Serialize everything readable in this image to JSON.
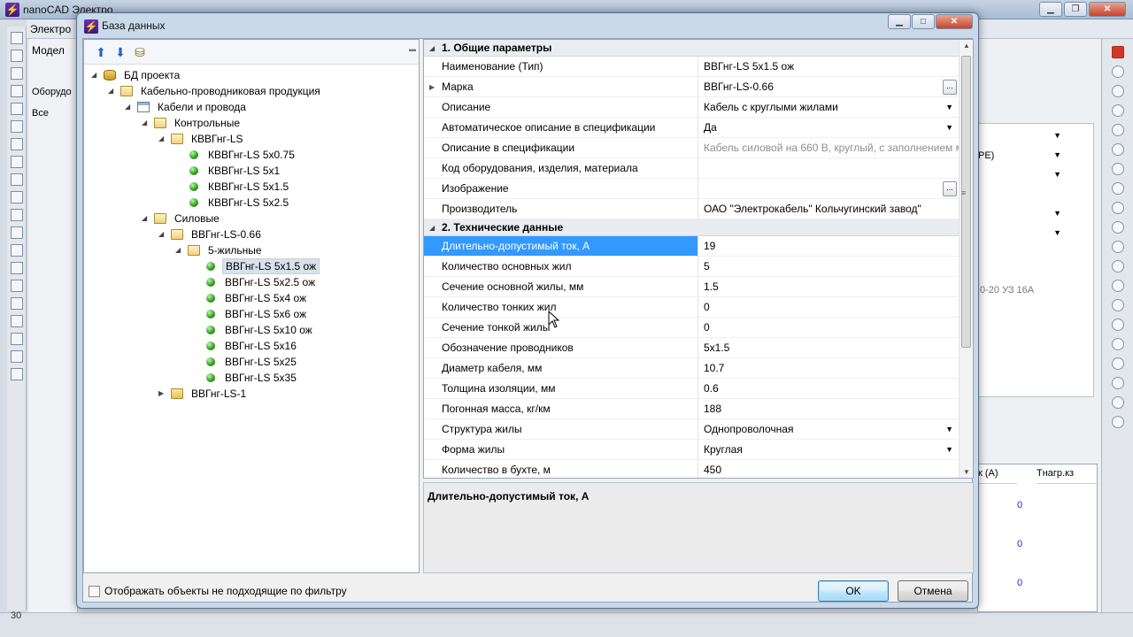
{
  "background_app": {
    "title": "nanoCAD Электро",
    "ribbon_title": "Электро",
    "panel_tab": "Модел",
    "panel_tab2": "Оборудо",
    "panel_filter": "Все",
    "right_rows": [
      "PE)"
    ],
    "right_label": "0-20 УЗ 16А",
    "right_table_header1": "к (А)",
    "right_table_header2": "Тнагр.кз",
    "right_table_values": [
      "0",
      "0",
      "0"
    ],
    "status_number": "30"
  },
  "dialog": {
    "title": "База данных",
    "tree": [
      {
        "label": "БД проекта",
        "level": 0,
        "icon": "database-icon",
        "expanded": true
      },
      {
        "label": "Кабельно-проводниковая продукция",
        "level": 1,
        "icon": "folder-open-icon",
        "expanded": true
      },
      {
        "label": "Кабели и провода",
        "level": 2,
        "icon": "table-icon",
        "expanded": true
      },
      {
        "label": "Контрольные",
        "level": 3,
        "icon": "folder-open-icon",
        "expanded": true
      },
      {
        "label": "КВВГнг-LS",
        "level": 4,
        "icon": "folder-open-icon",
        "expanded": true
      },
      {
        "label": "КВВГнг-LS 5x0.75",
        "level": 5,
        "icon": "item-ball-icon"
      },
      {
        "label": "КВВГнг-LS 5x1",
        "level": 5,
        "icon": "item-ball-icon"
      },
      {
        "label": "КВВГнг-LS 5x1.5",
        "level": 5,
        "icon": "item-ball-icon"
      },
      {
        "label": "КВВГнг-LS 5x2.5",
        "level": 5,
        "icon": "item-ball-icon"
      },
      {
        "label": "Силовые",
        "level": 3,
        "icon": "folder-open-icon",
        "expanded": true
      },
      {
        "label": "ВВГнг-LS-0.66",
        "level": 4,
        "icon": "folder-open-icon",
        "expanded": true
      },
      {
        "label": "5-жильные",
        "level": 5,
        "icon": "folder-open-icon",
        "expanded": true
      },
      {
        "label": "ВВГнг-LS 5x1.5 ож",
        "level": 6,
        "icon": "item-ball-icon",
        "selected": true
      },
      {
        "label": "ВВГнг-LS 5x2.5 ож",
        "level": 6,
        "icon": "item-ball-icon"
      },
      {
        "label": "ВВГнг-LS 5x4 ож",
        "level": 6,
        "icon": "item-ball-icon"
      },
      {
        "label": "ВВГнг-LS 5x6 ож",
        "level": 6,
        "icon": "item-ball-icon"
      },
      {
        "label": "ВВГнг-LS 5x10 ож",
        "level": 6,
        "icon": "item-ball-icon"
      },
      {
        "label": "ВВГнг-LS 5x16",
        "level": 6,
        "icon": "item-ball-icon"
      },
      {
        "label": "ВВГнг-LS 5x25",
        "level": 6,
        "icon": "item-ball-icon"
      },
      {
        "label": "ВВГнг-LS 5x35",
        "level": 6,
        "icon": "item-ball-icon"
      },
      {
        "label": "ВВГнг-LS-1",
        "level": 4,
        "icon": "folder-icon",
        "expanded": false
      }
    ],
    "categories": {
      "general": "1. Общие параметры",
      "technical": "2. Технические данные"
    },
    "properties_general": [
      {
        "name": "Наименование (Тип)",
        "value": "ВВГнг-LS 5x1.5 ож"
      },
      {
        "name": "Марка",
        "value": "ВВГнг-LS-0.66",
        "expandable": true,
        "button": "..."
      },
      {
        "name": "Описание",
        "value": "Кабель с круглыми жилами",
        "dropdown": true
      },
      {
        "name": "Автоматическое описание в спецификации",
        "value": "Да",
        "dropdown": true
      },
      {
        "name": "Описание в спецификации",
        "value": "Кабель силовой на 660 В, круглый, с заполнением м",
        "gray": true
      },
      {
        "name": "Код оборудования, изделия, материала",
        "value": ""
      },
      {
        "name": "Изображение",
        "value": "",
        "button": "..."
      },
      {
        "name": "Производитель",
        "value": "ОАО \"Электрокабель\" Кольчугинский завод\""
      }
    ],
    "properties_technical": [
      {
        "name": "Длительно-допустимый ток, А",
        "value": "19",
        "selected": true
      },
      {
        "name": "Количество основных жил",
        "value": "5"
      },
      {
        "name": "Сечение основной жилы, мм",
        "value": "1.5"
      },
      {
        "name": "Количество тонких жил",
        "value": "0"
      },
      {
        "name": "Сечение тонкой жилы",
        "value": "0"
      },
      {
        "name": "Обозначение проводников",
        "value": "5x1.5"
      },
      {
        "name": "Диаметр кабеля, мм",
        "value": "10.7"
      },
      {
        "name": "Толщина изоляции, мм",
        "value": "0.6"
      },
      {
        "name": "Погонная масса, кг/км",
        "value": "188"
      },
      {
        "name": "Структура жилы",
        "value": "Однопроволочная",
        "dropdown": true
      },
      {
        "name": "Форма жилы",
        "value": "Круглая",
        "dropdown": true
      },
      {
        "name": "Количество в бухте, м",
        "value": "450"
      }
    ],
    "description_title": "Длительно-допустимый ток, А",
    "filter_checkbox_label": "Отображать объекты не подходящие по фильтру",
    "filter_checked": false,
    "ok_label": "OK",
    "cancel_label": "Отмена"
  }
}
